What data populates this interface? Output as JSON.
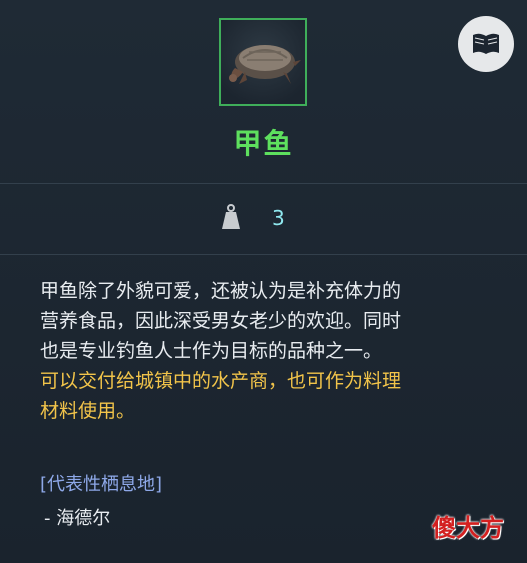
{
  "item": {
    "name": "甲鱼",
    "icon": "turtle-icon",
    "accent_color": "#5ee05e",
    "border_color": "#3fae5a"
  },
  "stats": {
    "weight_icon": "weight-icon",
    "weight_value": "3"
  },
  "description": {
    "lines": [
      "甲鱼除了外貌可爱，还被认为是补充体力的",
      "营养食品，因此深受男女老少的欢迎。同时",
      "也是专业钓鱼人士作为目标的品种之一。"
    ],
    "highlight_lines": [
      "可以交付给城镇中的水产商，也可作为料理",
      "材料使用。"
    ],
    "highlight_color": "#f2c44a"
  },
  "habitat": {
    "title": "[代表性栖息地]",
    "items": [
      "- 海德尔"
    ]
  },
  "book_button_icon": "book-icon",
  "watermark": "傻大方"
}
